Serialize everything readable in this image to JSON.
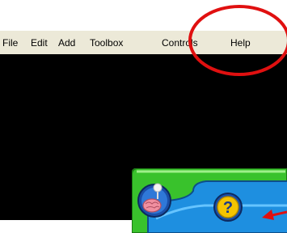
{
  "menu": {
    "items": [
      {
        "label": "File"
      },
      {
        "label": "Edit"
      },
      {
        "label": "Add"
      },
      {
        "label": "Toolbox"
      },
      {
        "label": "Controls"
      },
      {
        "label": "Help"
      }
    ]
  },
  "panel": {
    "help_glyph": "?"
  },
  "icons": {
    "brain": "brain-icon",
    "help": "question-mark-icon"
  },
  "colors": {
    "menubar": "#ece9d8",
    "canvas": "#000000",
    "panel_green": "#39c22c",
    "panel_blue": "#1e8fe0",
    "help_yellow": "#f5c400",
    "annotation_red": "#e01010"
  }
}
